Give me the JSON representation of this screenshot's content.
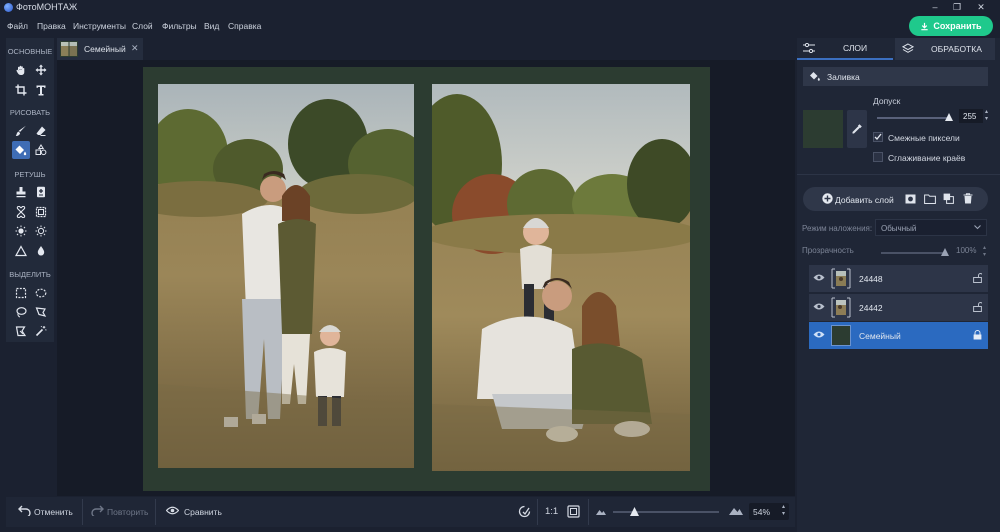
{
  "window": {
    "app_title": "ФотоМОНТАЖ",
    "controls": [
      "–",
      "❐",
      "✕"
    ]
  },
  "menu": {
    "items": [
      "Файл",
      "Правка",
      "Инструменты",
      "Слой",
      "Фильтры",
      "Вид",
      "Справка"
    ]
  },
  "save_button": {
    "label": "Сохранить",
    "color": "#1fc98c"
  },
  "tools": {
    "sections": [
      "ОСНОВНЫЕ",
      "РИСОВАТЬ",
      "РЕТУШЬ",
      "ВЫДЕЛИТЬ"
    ],
    "items": [
      "hand-icon",
      "move-icon",
      "crop-icon",
      "text-icon",
      "brush-icon",
      "eraser-icon",
      "fill-icon",
      "clone-icon",
      "stamp-icon",
      "patch-icon",
      "heal-icon",
      "frame-icon",
      "sun-icon",
      "brightness-icon",
      "triangle-icon",
      "drop-icon",
      "rect-select-icon",
      "ellipse-select-icon",
      "lasso-icon",
      "poly-lasso-icon",
      "magnetic-lasso-icon",
      "magic-wand-icon"
    ],
    "active": "fill-icon"
  },
  "document_tab": {
    "label": "Семейный",
    "close": "✕"
  },
  "collage": {
    "background": "#2c3c31"
  },
  "bottom_bar": {
    "undo_label": "Отменить",
    "redo_label": "Повторить",
    "compare_label": "Сравнить",
    "ratio_label": "1:1",
    "zoom_value": "54%",
    "zoom_fraction": 0.2
  },
  "right_panel": {
    "tab_layers": "СЛОИ",
    "tab_processing": "ОБРАБОТКА",
    "fill_header": "Заливка",
    "fill_color": "#2c3c31",
    "tolerance_label": "Допуск",
    "tolerance_value": "255",
    "tolerance_fraction": 1.0,
    "contiguous_label": "Смежные пиксели",
    "contiguous_checked": true,
    "antialias_label": "Сглаживание краёв",
    "antialias_checked": false,
    "add_layer_label": "Добавить слой",
    "blend_mode_label": "Режим наложения:",
    "blend_mode_value": "Обычный",
    "opacity_label": "Прозрачность",
    "opacity_value": "100%",
    "opacity_fraction": 1.0,
    "layers": [
      {
        "name": "24448",
        "selected": false,
        "locked": false
      },
      {
        "name": "24442",
        "selected": false,
        "locked": false
      },
      {
        "name": "Семейный",
        "selected": true,
        "locked": true
      }
    ]
  }
}
